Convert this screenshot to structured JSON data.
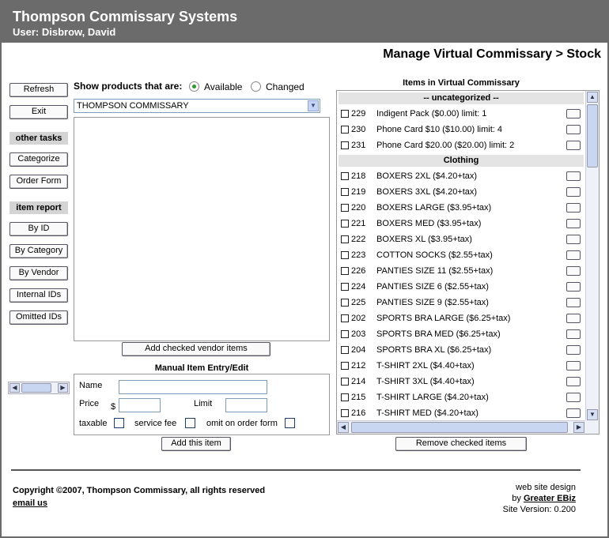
{
  "header": {
    "title": "Thompson Commissary Systems",
    "user": "User: Disbrow, David"
  },
  "page_title": "Manage Virtual Commissary > Stock",
  "left_nav": {
    "refresh": "Refresh",
    "exit": "Exit",
    "other_tasks": "other tasks",
    "categorize": "Categorize",
    "order_form": "Order Form",
    "item_report": "item report",
    "by_id": "By ID",
    "by_category": "By Category",
    "by_vendor": "By Vendor",
    "internal_ids": "Internal IDs",
    "omitted_ids": "Omitted IDs"
  },
  "filter": {
    "label": "Show products that are:",
    "opt_available": "Available",
    "opt_changed": "Changed",
    "selected": "Available"
  },
  "vendor_select": {
    "value": "THOMPSON COMMISSARY"
  },
  "add_vendor_button": "Add checked vendor items",
  "manual": {
    "title": "Manual Item Entry/Edit",
    "name_label": "Name",
    "price_label": "Price",
    "currency": "$",
    "limit_label": "Limit",
    "taxable_label": "taxable",
    "service_fee_label": "service fee",
    "omit_label": "omit on order form",
    "add_button": "Add this item"
  },
  "items_panel": {
    "title": "Items in Virtual Commissary",
    "remove_button": "Remove checked items",
    "groups": [
      {
        "category": "-- uncategorized --",
        "items": [
          {
            "id": "229",
            "name": "Indigent Pack ($0.00) limit: 1"
          },
          {
            "id": "230",
            "name": "Phone Card $10 ($10.00) limit: 4"
          },
          {
            "id": "231",
            "name": "Phone Card $20.00 ($20.00) limit: 2"
          }
        ]
      },
      {
        "category": "Clothing",
        "items": [
          {
            "id": "218",
            "name": "BOXERS 2XL ($4.20+tax)"
          },
          {
            "id": "219",
            "name": "BOXERS 3XL ($4.20+tax)"
          },
          {
            "id": "220",
            "name": "BOXERS LARGE ($3.95+tax)"
          },
          {
            "id": "221",
            "name": "BOXERS MED ($3.95+tax)"
          },
          {
            "id": "222",
            "name": "BOXERS XL ($3.95+tax)"
          },
          {
            "id": "223",
            "name": "COTTON SOCKS ($2.55+tax)"
          },
          {
            "id": "226",
            "name": "PANTIES SIZE 11 ($2.55+tax)"
          },
          {
            "id": "224",
            "name": "PANTIES SIZE 6 ($2.55+tax)"
          },
          {
            "id": "225",
            "name": "PANTIES SIZE 9 ($2.55+tax)"
          },
          {
            "id": "202",
            "name": "SPORTS BRA LARGE ($6.25+tax)"
          },
          {
            "id": "203",
            "name": "SPORTS BRA MED ($6.25+tax)"
          },
          {
            "id": "204",
            "name": "SPORTS BRA XL ($6.25+tax)"
          },
          {
            "id": "212",
            "name": "T-SHIRT 2XL ($4.40+tax)"
          },
          {
            "id": "214",
            "name": "T-SHIRT 3XL ($4.40+tax)"
          },
          {
            "id": "215",
            "name": "T-SHIRT LARGE ($4.20+tax)"
          },
          {
            "id": "216",
            "name": "T-SHIRT MED ($4.20+tax)"
          }
        ]
      }
    ]
  },
  "footer": {
    "copyright": "Copyright ©2007, Thompson Commissary, all rights reserved",
    "email": "email us",
    "design_line": "web site design",
    "by": "by",
    "designer": "Greater EBiz",
    "version": "Site Version: 0.200"
  },
  "colors": {
    "header_bg": "#6b6b6b",
    "section_bg": "#d4d4d4",
    "radio_accent": "#2a9a2a"
  }
}
